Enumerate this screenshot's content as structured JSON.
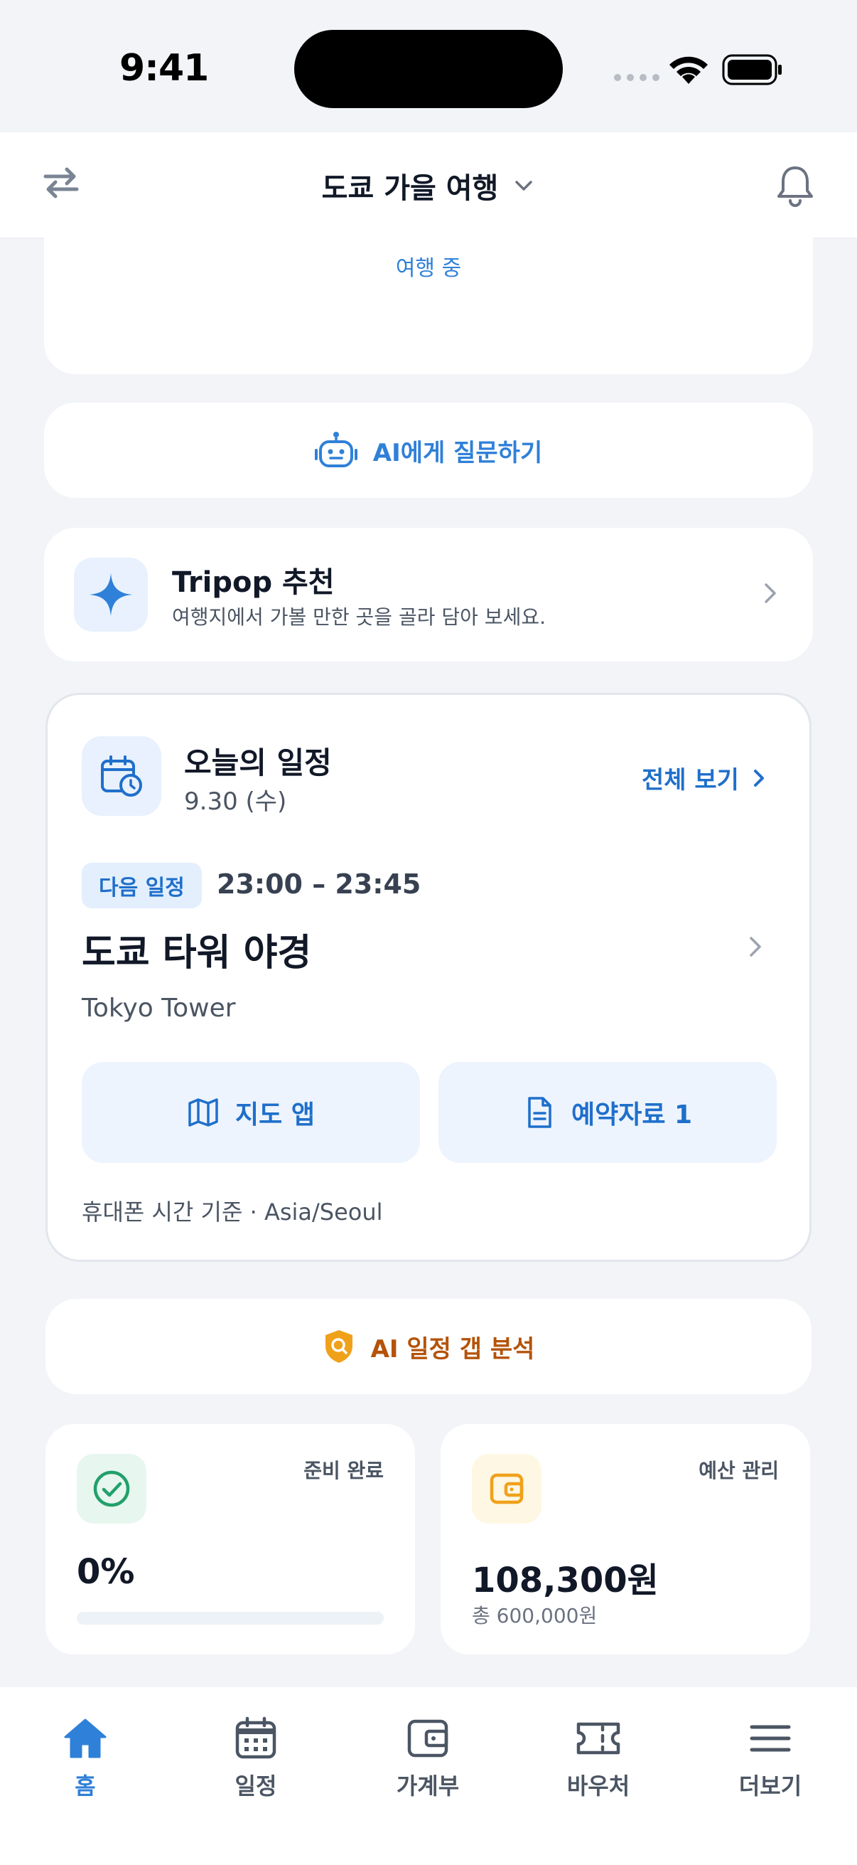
{
  "status_bar": {
    "time": "9:41"
  },
  "header": {
    "trip_title": "도쿄 가을 여행"
  },
  "trip_status": {
    "text": "여행 중"
  },
  "ai_ask": {
    "label": "AI에게 질문하기"
  },
  "recommend": {
    "title": "Tripop 추천",
    "subtitle": "여행지에서 가볼 만한 곳을 골라 담아 보세요."
  },
  "schedule": {
    "title": "오늘의 일정",
    "date": "9.30 (수)",
    "view_all": "전체 보기",
    "next_badge": "다음 일정",
    "next_time": "23:00 – 23:45",
    "event_title": "도쿄 타워 야경",
    "event_place": "Tokyo Tower",
    "map_button": "지도 앱",
    "doc_button": "예약자료 1",
    "timezone_note": "휴대폰 시간 기준 · Asia/Seoul"
  },
  "ai_gap": {
    "label": "AI 일정 갭 분석"
  },
  "prep": {
    "label": "준비 완료",
    "value": "0%",
    "progress_percent": 0
  },
  "budget": {
    "label": "예산 관리",
    "value": "108,300원",
    "total": "총 600,000원"
  },
  "bottom_nav": {
    "items": [
      {
        "label": "홈",
        "icon": "home-icon",
        "active": true
      },
      {
        "label": "일정",
        "icon": "calendar-icon",
        "active": false
      },
      {
        "label": "가계부",
        "icon": "wallet-icon",
        "active": false
      },
      {
        "label": "바우처",
        "icon": "ticket-icon",
        "active": false
      },
      {
        "label": "더보기",
        "icon": "menu-icon",
        "active": false
      }
    ]
  },
  "colors": {
    "accent": "#2F80D8",
    "accent_dark": "#1F6FCB",
    "warning": "#B45309",
    "success": "#22A06B",
    "budget": "#F0A11A"
  }
}
